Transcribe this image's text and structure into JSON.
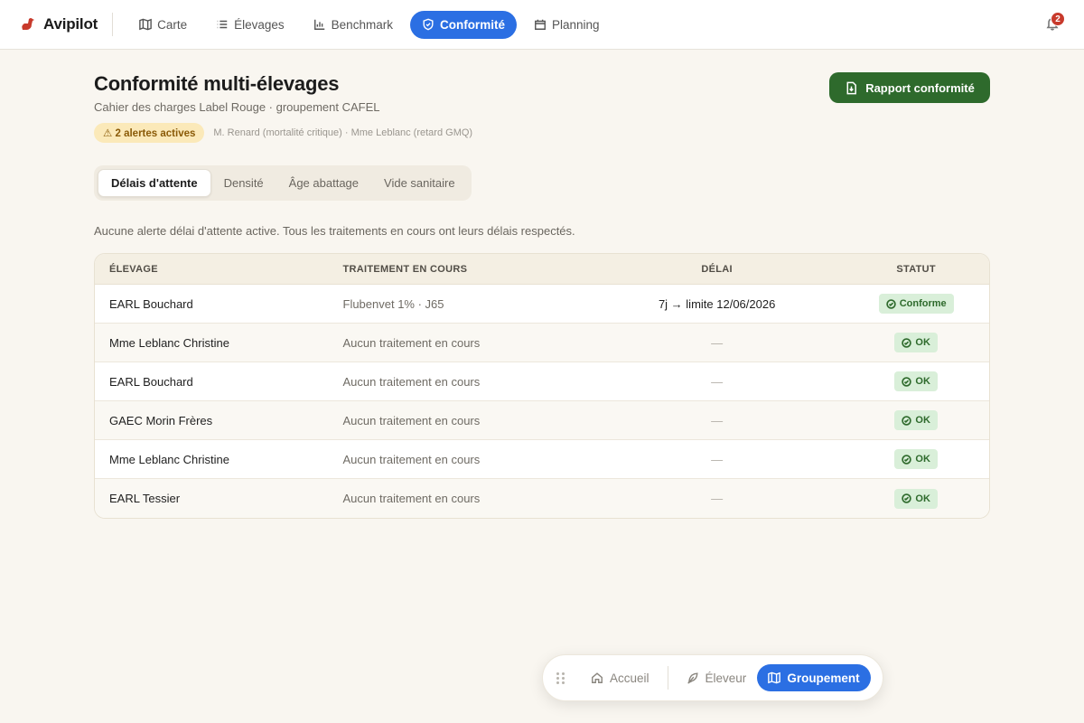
{
  "brand": {
    "name": "Avipilot",
    "accent": "#c83a2c"
  },
  "nav": {
    "items": [
      {
        "label": "Carte",
        "icon": "map-icon"
      },
      {
        "label": "Élevages",
        "icon": "list-icon"
      },
      {
        "label": "Benchmark",
        "icon": "bar-chart-icon"
      },
      {
        "label": "Conformité",
        "icon": "shield-icon",
        "active": true
      },
      {
        "label": "Planning",
        "icon": "calendar-icon"
      }
    ],
    "notifications_count": "2"
  },
  "page": {
    "title": "Conformité multi-élevages",
    "subtitle": "Cahier des charges Label Rouge · groupement CAFEL",
    "alert_badge": "⚠ 2 alertes actives",
    "alert_detail": "M. Renard (mortalité critique) · Mme Leblanc (retard GMQ)",
    "report_button": "Rapport conformité"
  },
  "tabs": [
    {
      "label": "Délais d'attente",
      "active": true
    },
    {
      "label": "Densité"
    },
    {
      "label": "Âge abattage"
    },
    {
      "label": "Vide sanitaire"
    }
  ],
  "info_text": "Aucune alerte délai d'attente active. Tous les traitements en cours ont leurs délais respectés.",
  "table": {
    "headers": [
      "ÉLEVAGE",
      "TRAITEMENT EN COURS",
      "DÉLAI",
      "STATUT"
    ],
    "rows": [
      {
        "elevage": "EARL Bouchard",
        "traitement": "Flubenvet 1% · J65",
        "delai": "7j → limite 12/06/2026",
        "statut": "Conforme"
      },
      {
        "elevage": "Mme Leblanc Christine",
        "traitement": "Aucun traitement en cours",
        "delai": "—",
        "statut": "OK"
      },
      {
        "elevage": "EARL Bouchard",
        "traitement": "Aucun traitement en cours",
        "delai": "—",
        "statut": "OK"
      },
      {
        "elevage": "GAEC Morin Frères",
        "traitement": "Aucun traitement en cours",
        "delai": "—",
        "statut": "OK"
      },
      {
        "elevage": "Mme Leblanc Christine",
        "traitement": "Aucun traitement en cours",
        "delai": "—",
        "statut": "OK"
      },
      {
        "elevage": "EARL Tessier",
        "traitement": "Aucun traitement en cours",
        "delai": "—",
        "statut": "OK"
      }
    ]
  },
  "bottom_nav": {
    "items": [
      {
        "label": "Accueil",
        "icon": "home-icon"
      },
      {
        "label": "Éleveur",
        "icon": "feather-icon"
      },
      {
        "label": "Groupement",
        "icon": "map-icon",
        "active": true
      }
    ]
  },
  "colors": {
    "primary_blue": "#2b6fe3",
    "primary_green": "#2e6a2c",
    "background": "#f9f6f0"
  }
}
